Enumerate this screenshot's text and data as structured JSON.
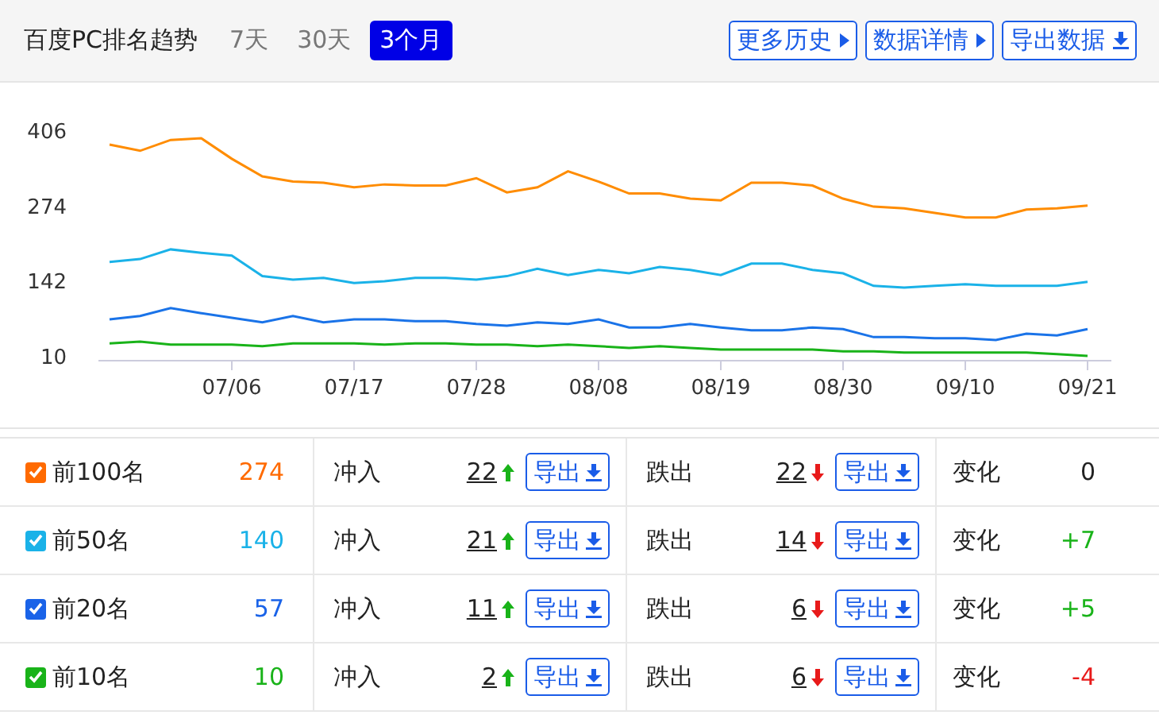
{
  "header": {
    "title": "百度PC排名趋势",
    "ranges": [
      {
        "label": "7天",
        "selected": false
      },
      {
        "label": "30天",
        "selected": false
      },
      {
        "label": "3个月",
        "selected": true
      }
    ],
    "actions": [
      {
        "label": "更多历史",
        "kind": "more"
      },
      {
        "label": "数据详情",
        "kind": "more"
      },
      {
        "label": "导出数据",
        "kind": "download"
      }
    ]
  },
  "chart": {
    "chart_data": {
      "type": "line",
      "categories": [
        null,
        null,
        null,
        null,
        "07/06",
        null,
        null,
        null,
        "07/17",
        null,
        null,
        null,
        "07/28",
        null,
        null,
        null,
        "08/08",
        null,
        null,
        null,
        "08/19",
        null,
        null,
        null,
        "08/30",
        null,
        null,
        null,
        "09/10",
        null,
        null,
        null,
        "09/21"
      ],
      "ylim": [
        10,
        406
      ],
      "yticks": [
        10,
        142,
        274,
        406
      ],
      "series": [
        {
          "color": "#ff8c00",
          "values": [
            381,
            370,
            389,
            392,
            356,
            325,
            316,
            314,
            306,
            311,
            309,
            309,
            322,
            297,
            306,
            334,
            316,
            295,
            295,
            286,
            283,
            314,
            314,
            309,
            286,
            272,
            269,
            261,
            253,
            253,
            267,
            269,
            274
          ]
        },
        {
          "color": "#1ab2e8",
          "values": [
            175,
            180,
            197,
            191,
            186,
            150,
            144,
            147,
            138,
            141,
            147,
            147,
            144,
            150,
            163,
            152,
            161,
            155,
            166,
            161,
            152,
            172,
            172,
            161,
            155,
            133,
            130,
            133,
            136,
            133,
            133,
            133,
            140
          ]
        },
        {
          "color": "#1a73e8",
          "values": [
            74,
            80,
            94,
            85,
            77,
            69,
            80,
            69,
            74,
            74,
            71,
            71,
            66,
            63,
            69,
            66,
            74,
            60,
            60,
            66,
            60,
            55,
            55,
            60,
            57,
            43,
            43,
            41,
            41,
            38,
            49,
            46,
            57
          ]
        },
        {
          "color": "#19b319",
          "values": [
            32,
            35,
            30,
            30,
            30,
            27,
            32,
            32,
            32,
            30,
            32,
            32,
            30,
            30,
            27,
            30,
            27,
            24,
            27,
            24,
            21,
            21,
            21,
            21,
            18,
            18,
            16,
            16,
            16,
            16,
            16,
            13,
            10
          ]
        }
      ]
    }
  },
  "rows": [
    {
      "name": "前100名",
      "checked": true,
      "color": "#ff6a00",
      "count": "274",
      "in_label": "冲入",
      "in": "22",
      "in_export": "导出",
      "out_label": "跌出",
      "out": "22",
      "out_export": "导出",
      "change_label": "变化",
      "change": {
        "text": "0",
        "color": "#222222"
      }
    },
    {
      "name": "前50名",
      "checked": true,
      "color": "#1ab2e8",
      "count": "140",
      "in_label": "冲入",
      "in": "21",
      "in_export": "导出",
      "out_label": "跌出",
      "out": "14",
      "out_export": "导出",
      "change_label": "变化",
      "change": {
        "text": "+7",
        "color": "#19b319"
      }
    },
    {
      "name": "前20名",
      "checked": true,
      "color": "#1a63e8",
      "count": "57",
      "in_label": "冲入",
      "in": "11",
      "in_export": "导出",
      "out_label": "跌出",
      "out": "6",
      "out_export": "导出",
      "change_label": "变化",
      "change": {
        "text": "+5",
        "color": "#19b319"
      }
    },
    {
      "name": "前10名",
      "checked": true,
      "color": "#19b319",
      "count": "10",
      "in_label": "冲入",
      "in": "2",
      "in_export": "导出",
      "out_label": "跌出",
      "out": "6",
      "out_export": "导出",
      "change_label": "变化",
      "change": {
        "text": "-4",
        "color": "#e81a1a"
      }
    }
  ]
}
